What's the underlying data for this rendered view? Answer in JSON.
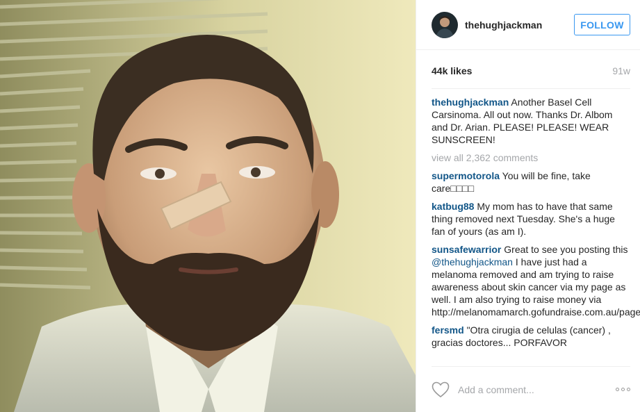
{
  "header": {
    "username": "thehughjackman",
    "follow_label": "FOLLOW"
  },
  "stats": {
    "likes": "44k likes",
    "age": "91w"
  },
  "caption": {
    "user": "thehughjackman",
    "text": "Another Basel Cell Carsinoma. All out now. Thanks Dr. Albom and Dr. Arian. PLEASE! PLEASE! WEAR SUNSCREEN!"
  },
  "view_all": "view all 2,362 comments",
  "comments": [
    {
      "user": "supermotorola",
      "text": "You will be fine, take care□□□□"
    },
    {
      "user": "katbug88",
      "text": "My mom has to have that same thing removed next Tuesday. She's a huge fan of yours (as am I)."
    },
    {
      "user": "sunsafewarrior",
      "text_before": "Great to see you posting this ",
      "mention": "@thehughjackman",
      "text_after": " I have just had a melanoma removed and am trying to raise awareness about skin cancer via my page as well. I am also trying to raise money via http://melanomamarch.gofundraise.com.au/page/KirstyPayne"
    },
    {
      "user": "fersmd",
      "text": "\"Otra cirugia de celulas (cancer) , gracias doctores... PORFAVOR"
    }
  ],
  "add_comment": {
    "placeholder": "Add a comment..."
  },
  "icons": {
    "like": "heart-outline-icon",
    "more": "more-options-icon"
  },
  "colors": {
    "accent": "#3897f0",
    "username": "#125688",
    "muted": "#a5a7aa"
  }
}
